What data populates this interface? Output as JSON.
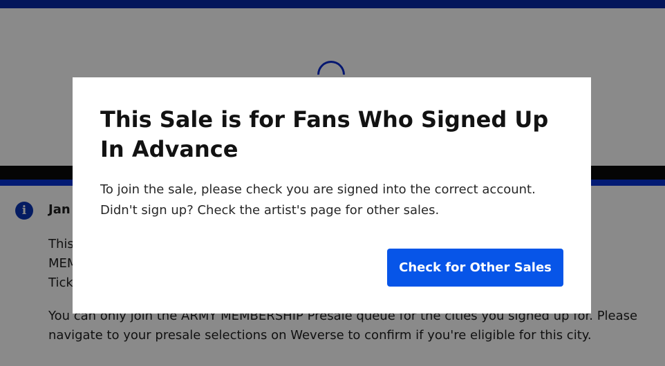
{
  "background": {
    "notice": {
      "icon": "info-icon",
      "icon_glyph": "i",
      "title": "Jan",
      "paragraph1_lines": [
        "This",
        "MEM",
        "Tick"
      ],
      "paragraph2": "You can only join the ARMY MEMBERSHIP Presale queue for the cities you signed up for. Please navigate to your presale selections on Weverse to confirm if you're eligible for this city."
    }
  },
  "modal": {
    "title": "This Sale is for Fans Who Signed Up In Advance",
    "body_line1": "To join the sale, please check you are signed into the correct account.",
    "body_line2": "Didn't sign up? Check the artist's page for other sales.",
    "button_label": "Check for Other Sales"
  },
  "colors": {
    "top_bar": "#082aa8",
    "accent_blue": "#0633d6",
    "button_bg": "#0755e8",
    "info_icon": "#0a35b5",
    "overlay": "rgba(0,0,0,0.46)"
  }
}
